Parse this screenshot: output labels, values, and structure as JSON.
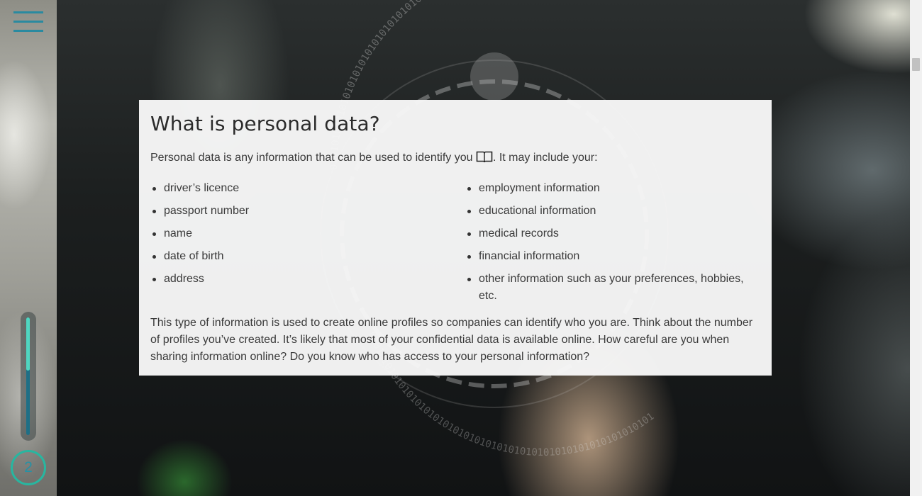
{
  "sidebar": {
    "page_number": "2",
    "progress_fraction": 0.45,
    "accent_color": "#28b6a0",
    "menu_icon": "hamburger-menu-icon"
  },
  "content": {
    "title": "What is personal data?",
    "intro_before_icon": "Personal data is any information that can be used to identify you ",
    "intro_icon": "glossary-book-icon",
    "intro_after_icon": ". It may include your:",
    "list_left": [
      "driver’s licence",
      "passport number",
      "name",
      "date of birth",
      "address"
    ],
    "list_right": [
      "employment information",
      "educational information",
      "medical records",
      "financial information",
      "other information such as your preferences, hobbies, etc."
    ],
    "outro": "This type of information is used to create online profiles so companies can identify who you are. Think about the number of profiles you’ve created. It’s likely that most of your confidential data is available online. How careful are you when sharing information online? Do you know who has access to your personal information?"
  },
  "background": {
    "binary_ring_text": "0101010101010101010101010101010101010101010101010101010101"
  }
}
